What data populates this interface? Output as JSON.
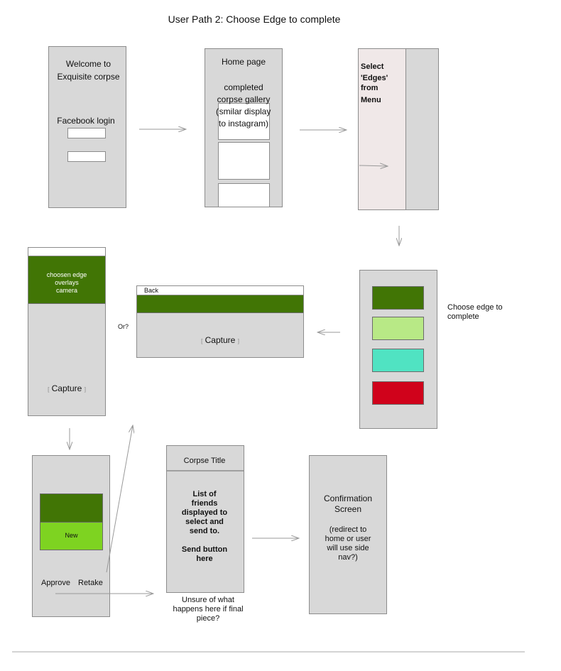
{
  "title": "User Path 2: Choose Edge to complete",
  "colors": {
    "dark_green": "#417505",
    "light_green": "#b8e986",
    "teal": "#50e3c2",
    "red": "#d0021b",
    "bright_green": "#7ed321",
    "screen_fill": "#d8d8d8",
    "menu_fill": "#f0e8e8"
  },
  "screen1": {
    "line1": "Welcome to",
    "line2": "Exquisite corpse",
    "login_label": "Facebook login"
  },
  "screen2": {
    "heading": "Home page",
    "desc1": "completed",
    "desc2": "corpse gallery",
    "desc3": "smilar display",
    "desc4": "to instagram)",
    "open_paren": "("
  },
  "screen3": {
    "line1": "Select",
    "line2": "'Edges'",
    "line3": "from",
    "line4": "Menu"
  },
  "screen4": {
    "note1": "Choose edge to",
    "note2": "complete"
  },
  "screen5": {
    "back": "Back",
    "capture": "Capture",
    "or_label": "Or?"
  },
  "screen6": {
    "overlay1": "choosen edge",
    "overlay2": "overlays",
    "overlay3": "camera",
    "capture": "Capture"
  },
  "brackets": {
    "open": "[",
    "close": "]"
  },
  "screen7": {
    "new_label": "New",
    "approve": "Approve",
    "retake": "Retake"
  },
  "screen8": {
    "heading": "Corpse Title",
    "body1": "List of",
    "body2": "friends",
    "body3": "displayed to",
    "body4": "select and",
    "body5": "send to.",
    "body6": "Send button",
    "body7": "here",
    "note1": "Unsure of what",
    "note2": "happens here if final",
    "note3": "piece?"
  },
  "screen9": {
    "heading1": "Confirmation",
    "heading2": "Screen",
    "body1": "(redirect to",
    "body2": "home or user",
    "body3": "will use side",
    "body4": "nav?)"
  }
}
